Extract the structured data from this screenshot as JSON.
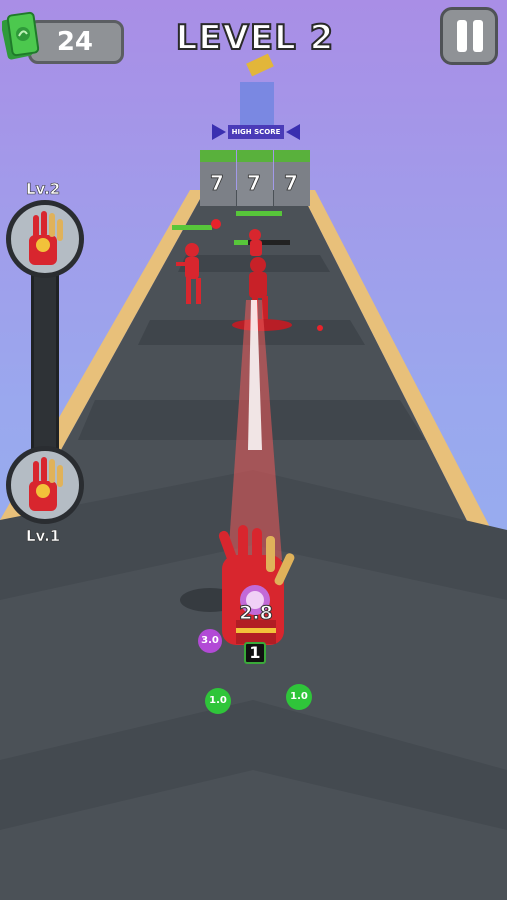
{
  "hud": {
    "cash_amount": "24",
    "level_title": "LEVEL 2",
    "pause_icon": "pause-icon",
    "cash_icon": "cash-icon"
  },
  "level_meter": {
    "top_label": "Lv.2",
    "bottom_label": "Lv.1",
    "progress": 0.07,
    "fill_color": "#3cc24a"
  },
  "world": {
    "high_score_sign": "HIGH SCORE",
    "wall_blocks": [
      "7",
      "7",
      "7"
    ],
    "power_value": "2.8",
    "ammo_count": "1",
    "orbs": [
      {
        "label": "3.0",
        "color": "#b24ad6"
      },
      {
        "label": "1.0",
        "color": "#2fc53a"
      },
      {
        "label": "1.0",
        "color": "#2fc53a"
      }
    ],
    "enemy_color": "#d8262e",
    "road_color": "#4b5157",
    "rail_color": "#e8c07a"
  }
}
